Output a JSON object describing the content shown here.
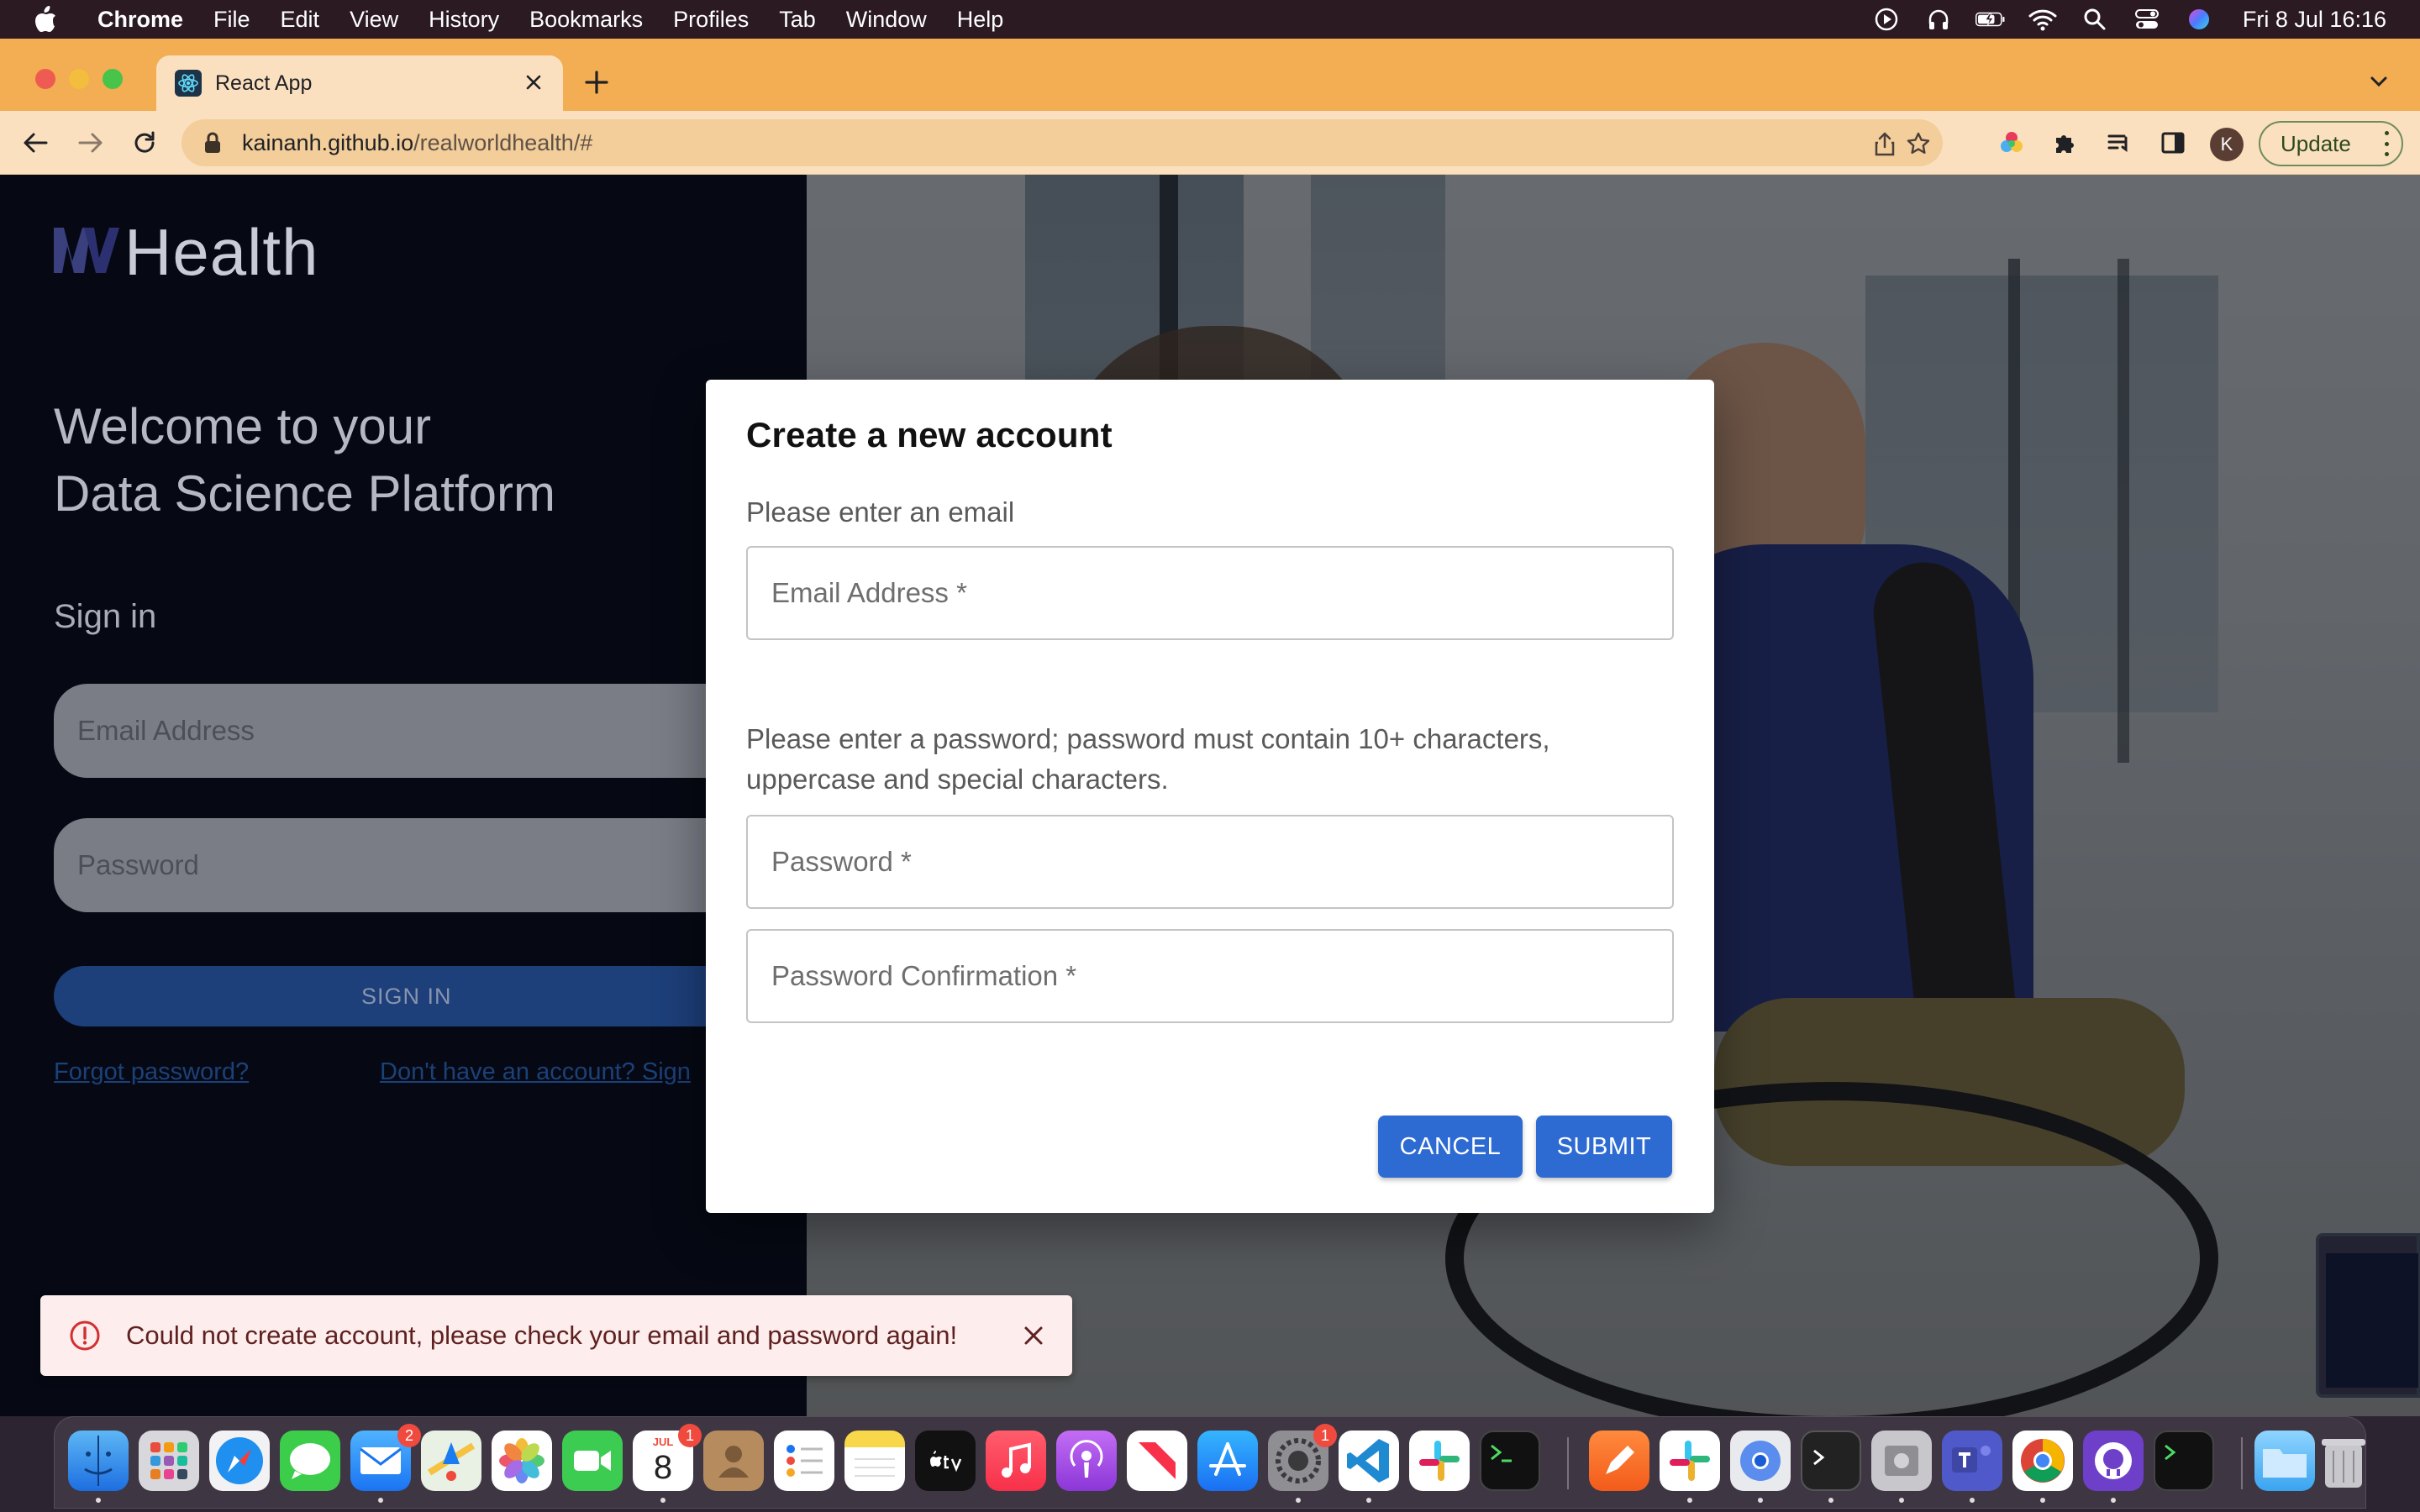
{
  "menubar": {
    "app_name": "Chrome",
    "items": [
      "File",
      "Edit",
      "View",
      "History",
      "Bookmarks",
      "Profiles",
      "Tab",
      "Window",
      "Help"
    ],
    "clock": "Fri 8 Jul  16:16"
  },
  "browser": {
    "tab_title": "React App",
    "url_host": "kainanh.github.io",
    "url_path": "/realworldhealth/#",
    "update_label": "Update",
    "profile_initial": "K"
  },
  "left_panel": {
    "brand": "Health",
    "welcome_line1": "Welcome to your",
    "welcome_line2": "Data Science Platform",
    "signin_heading": "Sign in",
    "email_placeholder": "Email Address",
    "password_placeholder": "Password",
    "signin_button": "SIGN IN",
    "forgot_link": "Forgot password?",
    "signup_link": "Don't have an account? Sign"
  },
  "modal": {
    "title": "Create a new account",
    "email_prompt": "Please enter an email",
    "email_label": "Email Address *",
    "password_prompt": "Please enter a password; password must contain 10+ characters, uppercase and special characters.",
    "password_label": "Password *",
    "password_confirm_label": "Password Confirmation *",
    "cancel_button": "CANCEL",
    "submit_button": "SUBMIT",
    "primary_color": "#2d6bd3"
  },
  "snackbar": {
    "message": "Could not create account, please check your email and password again!",
    "severity": "error"
  },
  "dock": {
    "mail_badge": "2",
    "calendar_month": "JUL",
    "calendar_day": "8",
    "calendar_badge": "1",
    "settings_badge": "1"
  }
}
